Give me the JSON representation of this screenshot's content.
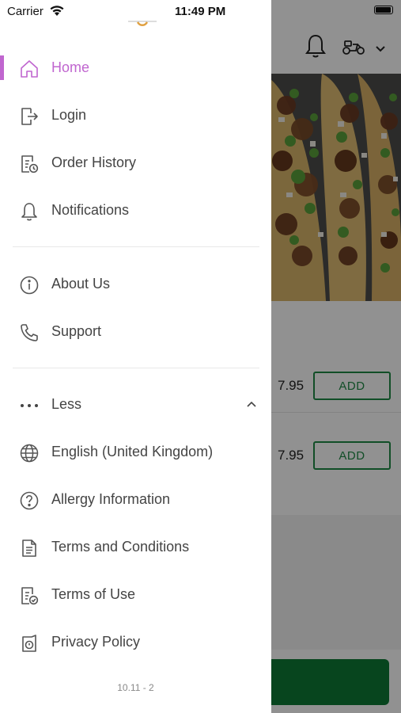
{
  "status_bar": {
    "carrier": "Carrier",
    "time": "11:49 PM"
  },
  "background": {
    "items": [
      {
        "price": "7.95",
        "add_label": "ADD"
      },
      {
        "price": "7.95",
        "add_label": "ADD"
      }
    ],
    "header_icons": [
      "bell-icon",
      "scooter-icon",
      "chevron-down-icon"
    ]
  },
  "menu": {
    "active_color": "#c066cf",
    "primary": [
      {
        "label": "Home",
        "icon": "home-icon",
        "active": true
      },
      {
        "label": "Login",
        "icon": "login-icon"
      },
      {
        "label": "Order History",
        "icon": "order-history-icon"
      },
      {
        "label": "Notifications",
        "icon": "bell-icon"
      }
    ],
    "secondary": [
      {
        "label": "About Us",
        "icon": "info-icon"
      },
      {
        "label": "Support",
        "icon": "phone-icon"
      }
    ],
    "more": {
      "label": "Less",
      "icon": "more-dots-icon",
      "expanded": true
    },
    "extra": [
      {
        "label": "English (United Kingdom)",
        "icon": "globe-icon"
      },
      {
        "label": "Allergy Information",
        "icon": "question-icon"
      },
      {
        "label": "Terms and Conditions",
        "icon": "document-icon"
      },
      {
        "label": "Terms of Use",
        "icon": "document-check-icon"
      },
      {
        "label": "Privacy Policy",
        "icon": "privacy-icon"
      }
    ]
  },
  "version": "10.11 - 2",
  "colors": {
    "accent": "#c066cf",
    "add_green": "#1e8a45",
    "checkout_green": "#0d7a36"
  }
}
